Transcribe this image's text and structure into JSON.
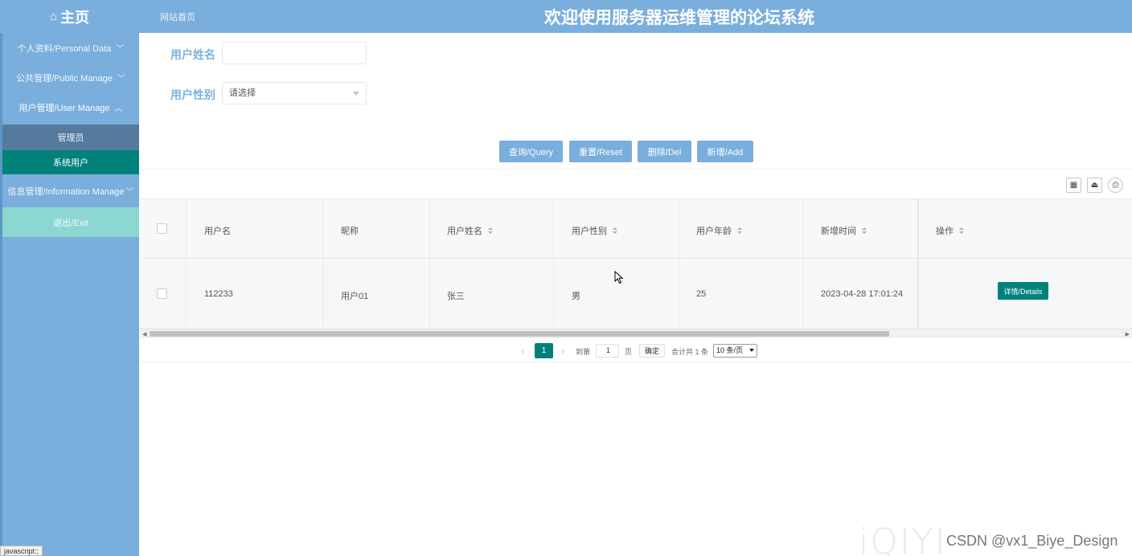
{
  "header": {
    "home_label": "主页",
    "home_icon": "home-icon",
    "site_link": "网站首页",
    "title": "欢迎使用服务器运维管理的论坛系统",
    "bg_color": "#7aaedc"
  },
  "sidebar": {
    "items": [
      {
        "label": "个人资料/Personal Data",
        "icon": "chevron-down-icon"
      },
      {
        "label": "公共管理/Public Manage",
        "icon": "chevron-down-icon"
      },
      {
        "label": "用户管理/User Manage",
        "icon": "chevron-up-icon"
      }
    ],
    "sub_items": [
      {
        "label": "管理员"
      },
      {
        "label": "系统用户"
      }
    ],
    "info_item": {
      "label": "信息管理/Information Manage",
      "icon": "chevron-down-icon"
    },
    "exit_label": "退出/Exit",
    "active_color": "#00827b"
  },
  "status_bar": {
    "text": "javascript:;"
  },
  "search": {
    "name_label": "用户姓名",
    "name_value": "",
    "gender_label": "用户性别",
    "gender_selected": "请选择"
  },
  "actions": {
    "query": "查询/Query",
    "reset": "重置/Reset",
    "delete": "删除/Del",
    "add": "新增/Add"
  },
  "toolbar_icons": [
    "columns-icon",
    "export-icon",
    "print-icon"
  ],
  "table": {
    "columns": [
      "用户名",
      "昵称",
      "用户姓名",
      "用户性别",
      "用户年龄",
      "新增时间",
      "操作"
    ],
    "rows": [
      {
        "username": "112233",
        "nickname": "用户01",
        "real_name": "张三",
        "gender": "男",
        "age": "25",
        "created": "2023-04-28 17:01:24",
        "action": "详情/Details"
      }
    ]
  },
  "pagination": {
    "current_page": "1",
    "goto_label": "到第",
    "goto_value": "1",
    "page_unit": "页",
    "confirm": "确定",
    "total": "合计共 1 条",
    "page_size": "10 条/页"
  },
  "watermark": {
    "logo": "iQIYI",
    "text": "CSDN @vx1_Biye_Design"
  }
}
